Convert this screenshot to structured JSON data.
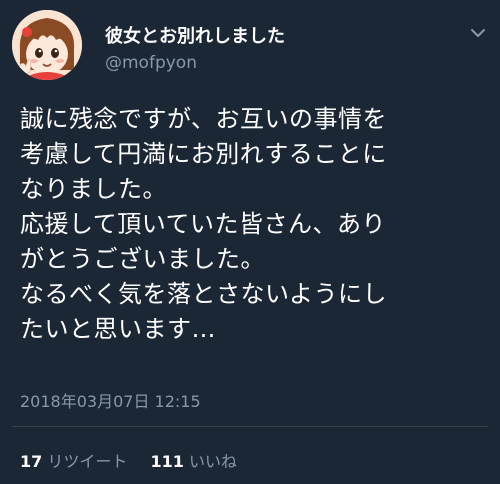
{
  "tweet": {
    "display_name": "彼女とお別れしました",
    "handle": "@mofpyon",
    "body_lines": [
      "誠に残念ですが、お互いの事情を",
      "考慮して円満にお別れすることに",
      "なりました。",
      "応援して頂いていた皆さん、あり",
      "がとうございました。",
      "なるべく気を落とさないようにし",
      "たいと思います…"
    ],
    "timestamp": "2018年03月07日 12:15",
    "retweets": {
      "count": "17",
      "label": "リツイート"
    },
    "likes": {
      "count": "111",
      "label": "いいね"
    }
  },
  "icons": {
    "avatar": "anime-girl-avatar",
    "menu": "chevron-down-icon"
  },
  "colors": {
    "background": "#1b2735",
    "primary_text": "#ffffff",
    "secondary_text": "#8899a6",
    "divider": "#38444d"
  }
}
